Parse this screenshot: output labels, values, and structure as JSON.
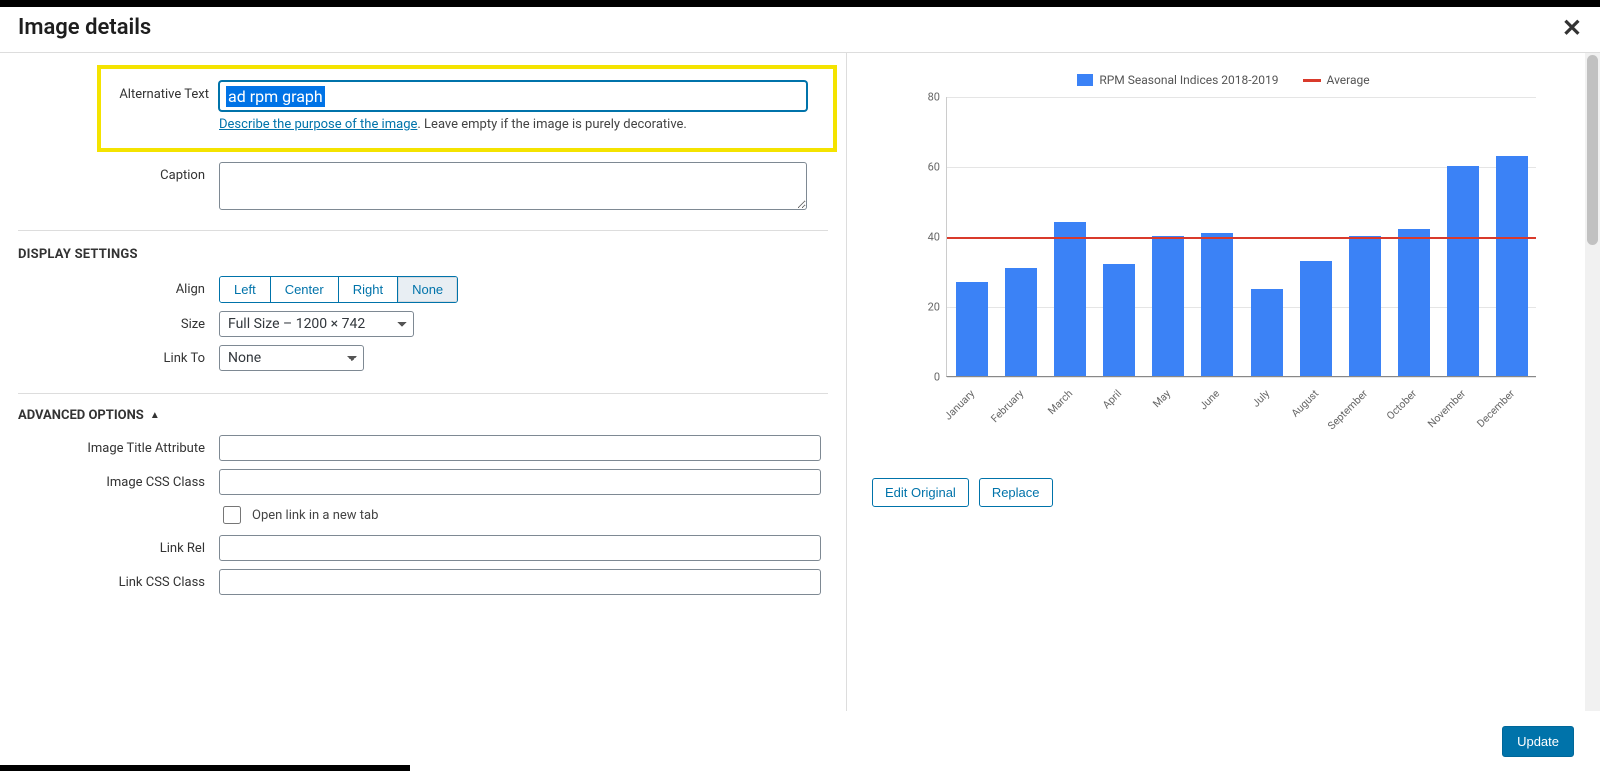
{
  "header": {
    "title": "Image details"
  },
  "alt_text": {
    "label": "Alternative Text",
    "value": "ad rpm graph",
    "hint_link": "Describe the purpose of the image",
    "hint_rest": ". Leave empty if the image is purely decorative."
  },
  "caption": {
    "label": "Caption",
    "value": ""
  },
  "display_settings": {
    "title": "DISPLAY SETTINGS",
    "align": {
      "label": "Align",
      "options": [
        "Left",
        "Center",
        "Right",
        "None"
      ],
      "selected": "None"
    },
    "size": {
      "label": "Size",
      "selected": "Full Size – 1200 × 742"
    },
    "link_to": {
      "label": "Link To",
      "selected": "None"
    }
  },
  "advanced": {
    "title": "ADVANCED OPTIONS",
    "image_title": {
      "label": "Image Title Attribute",
      "value": ""
    },
    "image_css": {
      "label": "Image CSS Class",
      "value": ""
    },
    "open_new_tab": {
      "label": "Open link in a new tab",
      "checked": false
    },
    "link_rel": {
      "label": "Link Rel",
      "value": ""
    },
    "link_css": {
      "label": "Link CSS Class",
      "value": ""
    }
  },
  "image_actions": {
    "edit": "Edit Original",
    "replace": "Replace"
  },
  "footer": {
    "update": "Update"
  },
  "chart_data": {
    "type": "bar",
    "title": "",
    "legend": {
      "series": "RPM Seasonal Indices 2018-2019",
      "average": "Average"
    },
    "categories": [
      "January",
      "February",
      "March",
      "April",
      "May",
      "June",
      "July",
      "August",
      "September",
      "October",
      "November",
      "December"
    ],
    "values": [
      27,
      31,
      44,
      32,
      40,
      41,
      25,
      33,
      40,
      42,
      60,
      63
    ],
    "average_value": 40,
    "ylabel": "",
    "xlabel": "",
    "ylim": [
      0,
      80
    ],
    "yticks": [
      0,
      20,
      40,
      60,
      80
    ]
  }
}
